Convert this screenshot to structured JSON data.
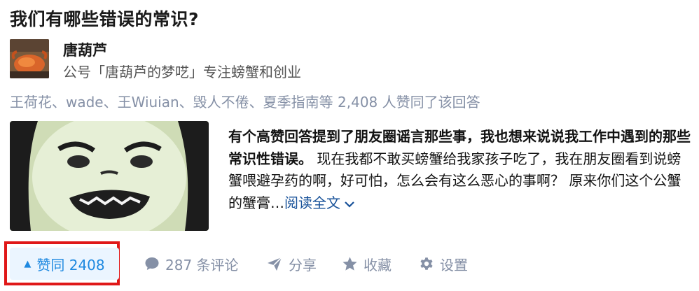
{
  "question": {
    "title": "我们有哪些错误的常识?"
  },
  "author": {
    "name": "唐葫芦",
    "bio": "公号「唐葫芦的梦呓」专注螃蟹和创业",
    "avatar_icon": "crab-photo-avatar"
  },
  "voters_line": "王荷花、wade、王Wiuian、毁人不倦、夏季指南等 2,408 人赞同了该回答",
  "excerpt": {
    "bold_text": "有个高赞回答提到了朋友圈谣言那些事，我也想来说说我工作中遇到的那些常识性错误。",
    "body_text": " 现在我都不敢买螃蟹给我家孩子吃了，我在朋友圈看到说螃蟹喂避孕药的啊，好可怕，怎么会有这么恶心的事啊？ 原来你们这个公蟹的蟹膏…",
    "read_more": "阅读全文",
    "thumbnail_icon": "panda-meme-image"
  },
  "actions": {
    "vote_label": "赞同 2408",
    "comments_label": "287 条评论",
    "share_label": "分享",
    "favorite_label": "收藏",
    "settings_label": "设置"
  },
  "colors": {
    "vote_text": "#1e89e0",
    "vote_bg": "#ebf5ff",
    "meta_gray": "#8590a6",
    "link_blue": "#175199",
    "highlight_red": "#e01818"
  }
}
